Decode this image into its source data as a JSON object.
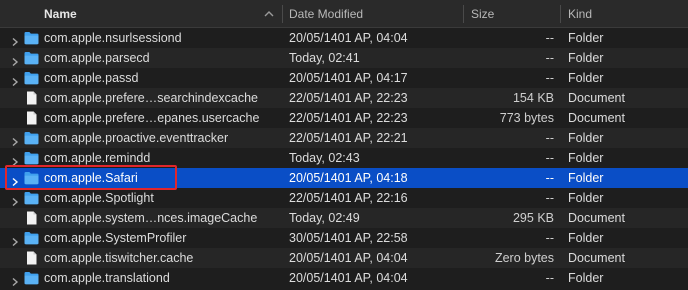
{
  "header": {
    "name": "Name",
    "date_modified": "Date Modified",
    "size": "Size",
    "kind": "Kind"
  },
  "rows": [
    {
      "name": "com.apple.nsurlsessiond",
      "date": "20/05/1401 AP, 04:04",
      "size": "--",
      "kind": "Folder",
      "type": "folder"
    },
    {
      "name": "com.apple.parsecd",
      "date": "Today, 02:41",
      "size": "--",
      "kind": "Folder",
      "type": "folder"
    },
    {
      "name": "com.apple.passd",
      "date": "20/05/1401 AP, 04:17",
      "size": "--",
      "kind": "Folder",
      "type": "folder"
    },
    {
      "name": "com.apple.prefere…searchindexcache",
      "date": "22/05/1401 AP, 22:23",
      "size": "154 KB",
      "kind": "Document",
      "type": "document"
    },
    {
      "name": "com.apple.prefere…epanes.usercache",
      "date": "22/05/1401 AP, 22:23",
      "size": "773 bytes",
      "kind": "Document",
      "type": "document"
    },
    {
      "name": "com.apple.proactive.eventtracker",
      "date": "22/05/1401 AP, 22:21",
      "size": "--",
      "kind": "Folder",
      "type": "folder"
    },
    {
      "name": "com.apple.remindd",
      "date": "Today, 02:43",
      "size": "--",
      "kind": "Folder",
      "type": "folder"
    },
    {
      "name": "com.apple.Safari",
      "date": "20/05/1401 AP, 04:18",
      "size": "--",
      "kind": "Folder",
      "type": "folder",
      "selected": true
    },
    {
      "name": "com.apple.Spotlight",
      "date": "22/05/1401 AP, 22:16",
      "size": "--",
      "kind": "Folder",
      "type": "folder"
    },
    {
      "name": "com.apple.system…nces.imageCache",
      "date": "Today, 02:49",
      "size": "295 KB",
      "kind": "Document",
      "type": "document"
    },
    {
      "name": "com.apple.SystemProfiler",
      "date": "30/05/1401 AP, 22:58",
      "size": "--",
      "kind": "Folder",
      "type": "folder"
    },
    {
      "name": "com.apple.tiswitcher.cache",
      "date": "20/05/1401 AP, 04:04",
      "size": "Zero bytes",
      "kind": "Document",
      "type": "document"
    },
    {
      "name": "com.apple.translationd",
      "date": "20/05/1401 AP, 04:04",
      "size": "--",
      "kind": "Folder",
      "type": "folder"
    }
  ],
  "colors": {
    "background": "#1e1e1e",
    "alt_row": "#262626",
    "selection": "#0a4ec6",
    "folder": "#3fa0ee",
    "highlight": "#e0262b"
  }
}
